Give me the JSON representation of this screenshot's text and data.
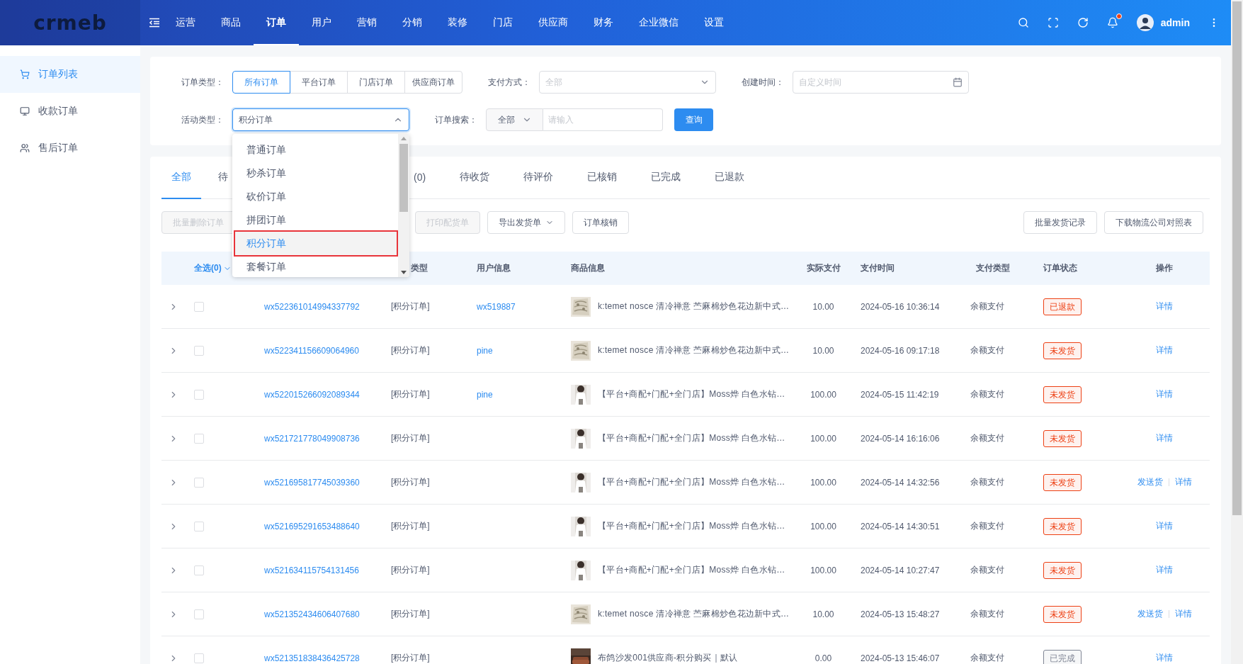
{
  "header": {
    "logo": "crmeb",
    "nav": [
      {
        "label": "运营",
        "selected": false
      },
      {
        "label": "商品",
        "selected": false
      },
      {
        "label": "订单",
        "selected": true
      },
      {
        "label": "用户",
        "selected": false
      },
      {
        "label": "营销",
        "selected": false
      },
      {
        "label": "分销",
        "selected": false
      },
      {
        "label": "装修",
        "selected": false
      },
      {
        "label": "门店",
        "selected": false
      },
      {
        "label": "供应商",
        "selected": false
      },
      {
        "label": "财务",
        "selected": false
      },
      {
        "label": "企业微信",
        "selected": false
      },
      {
        "label": "设置",
        "selected": false
      }
    ],
    "notification": true,
    "user": "admin"
  },
  "sidebar": {
    "items": [
      {
        "label": "订单列表",
        "kind": "cart",
        "selected": true
      },
      {
        "label": "收款订单",
        "kind": "monitor",
        "selected": false
      },
      {
        "label": "售后订单",
        "kind": "users",
        "selected": false
      }
    ]
  },
  "filters": {
    "order_type": {
      "label": "订单类型：",
      "options": [
        {
          "label": "所有订单",
          "selected": true
        },
        {
          "label": "平台订单",
          "selected": false
        },
        {
          "label": "门店订单",
          "selected": false
        },
        {
          "label": "供应商订单",
          "selected": false
        }
      ]
    },
    "payment": {
      "label": "支付方式：",
      "placeholder": "全部"
    },
    "created": {
      "label": "创建时间：",
      "placeholder": "自定义时间"
    },
    "activity": {
      "label": "活动类型：",
      "value": "积分订单",
      "expanded": true,
      "options": [
        {
          "label": "普通订单",
          "selected": false
        },
        {
          "label": "秒杀订单",
          "selected": false
        },
        {
          "label": "砍价订单",
          "selected": false
        },
        {
          "label": "拼团订单",
          "selected": false
        },
        {
          "label": "积分订单",
          "selected": true
        },
        {
          "label": "套餐订单",
          "selected": false
        }
      ]
    },
    "search": {
      "label": "订单搜索：",
      "scope": "全部",
      "placeholder": "请输入"
    },
    "submit": "查询"
  },
  "tabs": [
    {
      "label": "全部",
      "selected": true
    },
    {
      "label": "待",
      "selected": false
    },
    {
      "label": "(0)",
      "selected": false
    },
    {
      "label": "待收货",
      "selected": false
    },
    {
      "label": "待评价",
      "selected": false
    },
    {
      "label": "已核销",
      "selected": false
    },
    {
      "label": "已完成",
      "selected": false
    },
    {
      "label": "已退款",
      "selected": false
    }
  ],
  "toolbar": {
    "left": [
      {
        "label": "批量删除订单",
        "kind": "plain",
        "disabled": true
      },
      {
        "label": "打印配货单",
        "kind": "plain",
        "disabled": true
      },
      {
        "label": "导出发货单",
        "kind": "menu",
        "disabled": false
      },
      {
        "label": "订单核销",
        "kind": "plain",
        "disabled": false
      }
    ],
    "right": [
      {
        "label": "批量发货记录",
        "disabled": false
      },
      {
        "label": "下载物流公司对照表",
        "disabled": false
      }
    ]
  },
  "table": {
    "select_all": "全选(0)",
    "columns": [
      "类型",
      "用户信息",
      "商品信息",
      "实际支付",
      "支付时间",
      "支付类型",
      "订单状态",
      "操作"
    ],
    "rows": [
      {
        "order_no": "wx522361014994337792",
        "type": "[积分订单]",
        "user": "wx519887",
        "goods": "k:temet nosce 清冷禅意 苎麻棉炒色花边新中式…",
        "paid": "10.00",
        "paid_at": "2024-05-16 10:36:14",
        "pay_type": "余额支付",
        "status": {
          "text": "已退款",
          "color": "#ed4014"
        },
        "actions": [
          "详情"
        ],
        "checked": false,
        "expanded": false
      },
      {
        "order_no": "wx522341156609064960",
        "type": "[积分订单]",
        "user": "pine",
        "goods": "k:temet nosce 清冷禅意 苎麻棉炒色花边新中式…",
        "paid": "10.00",
        "paid_at": "2024-05-16 09:17:18",
        "pay_type": "余额支付",
        "status": {
          "text": "未发货",
          "color": "#ed4014"
        },
        "actions": [
          "详情"
        ],
        "checked": false,
        "expanded": false
      },
      {
        "order_no": "wx522015266092089344",
        "type": "[积分订单]",
        "user": "pine",
        "goods": "【平台+商配+门配+全门店】Moss烨 白色水钻…",
        "paid": "100.00",
        "paid_at": "2024-05-15 11:42:19",
        "pay_type": "余额支付",
        "status": {
          "text": "未发货",
          "color": "#ed4014"
        },
        "actions": [
          "详情"
        ],
        "checked": false,
        "expanded": false
      },
      {
        "order_no": "wx521721778049908736",
        "type": "[积分订单]",
        "goods": "【平台+商配+门配+全门店】Moss烨 白色水钻…",
        "paid": "100.00",
        "paid_at": "2024-05-14 16:16:06",
        "pay_type": "余额支付",
        "status": {
          "text": "未发货",
          "color": "#ed4014"
        },
        "actions": [
          "详情"
        ],
        "checked": false,
        "expanded": false
      },
      {
        "order_no": "wx521695817745039360",
        "type": "[积分订单]",
        "goods": "【平台+商配+门配+全门店】Moss烨 白色水钻…",
        "paid": "100.00",
        "paid_at": "2024-05-14 14:32:56",
        "pay_type": "余额支付",
        "status": {
          "text": "未发货",
          "color": "#ed4014"
        },
        "actions": [
          "发送货",
          "详情"
        ],
        "checked": false,
        "expanded": false
      },
      {
        "order_no": "wx521695291653488640",
        "type": "[积分订单]",
        "goods": "【平台+商配+门配+全门店】Moss烨 白色水钻…",
        "paid": "100.00",
        "paid_at": "2024-05-14 14:30:51",
        "pay_type": "余额支付",
        "status": {
          "text": "未发货",
          "color": "#ed4014"
        },
        "actions": [
          "详情"
        ],
        "checked": false,
        "expanded": false
      },
      {
        "order_no": "wx521634115754131456",
        "type": "[积分订单]",
        "goods": "【平台+商配+门配+全门店】Moss烨 白色水钻…",
        "paid": "100.00",
        "paid_at": "2024-05-14 10:27:47",
        "pay_type": "余额支付",
        "status": {
          "text": "未发货",
          "color": "#ed4014"
        },
        "actions": [
          "详情"
        ],
        "checked": false,
        "expanded": false
      },
      {
        "order_no": "wx521352434606407680",
        "type": "[积分订单]",
        "goods": "k:temet nosce 清冷禅意 苎麻棉炒色花边新中式…",
        "paid": "10.00",
        "paid_at": "2024-05-13 15:48:27",
        "pay_type": "余额支付",
        "status": {
          "text": "未发货",
          "color": "#ed4014"
        },
        "actions": [
          "发送货",
          "详情"
        ],
        "checked": false,
        "expanded": false
      },
      {
        "order_no": "wx521351838436425728",
        "type": "[积分订单]",
        "goods": "布鸽沙发001供应商-积分购买｜默认",
        "paid": "0.00",
        "paid_at": "2024-05-13 15:46:07",
        "pay_type": "余额支付",
        "status": {
          "text": "已完成",
          "color": "#808695"
        },
        "actions": [
          "详情"
        ],
        "checked": false,
        "expanded": false
      }
    ]
  }
}
